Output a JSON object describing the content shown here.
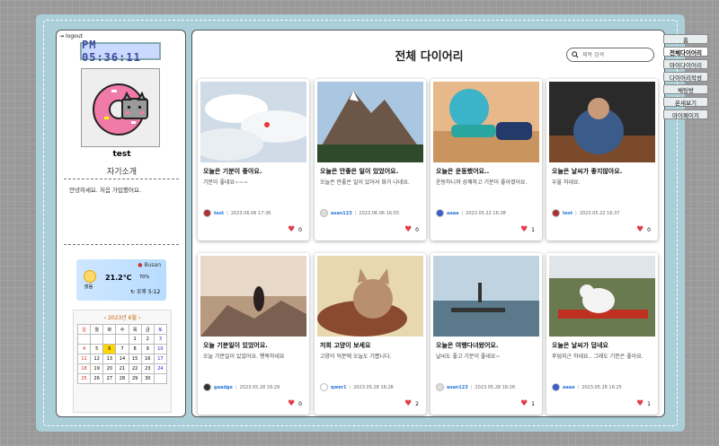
{
  "sidebar": {
    "logout_label": "logout",
    "clock": "PM 05:36:11",
    "username": "test",
    "intro_title": "자기소개",
    "intro_text": "안녕하세요. 처음 가입했어요.",
    "weather": {
      "location": "Busan",
      "temp": "21.2℃",
      "condition": "맑음",
      "humidity": "70%",
      "time": "오후 5:12"
    },
    "calendar": {
      "title": "2023년 6월",
      "weekdays": [
        "일",
        "월",
        "화",
        "수",
        "목",
        "금",
        "토"
      ],
      "weeks": [
        [
          "",
          "",
          "",
          "",
          "1",
          "2",
          "3"
        ],
        [
          "4",
          "5",
          "6",
          "7",
          "8",
          "9",
          "10"
        ],
        [
          "11",
          "12",
          "13",
          "14",
          "15",
          "16",
          "17"
        ],
        [
          "18",
          "19",
          "20",
          "21",
          "22",
          "23",
          "24"
        ],
        [
          "25",
          "26",
          "27",
          "28",
          "29",
          "30",
          ""
        ]
      ],
      "highlight": "6"
    }
  },
  "main": {
    "title": "전체 다이어리",
    "search_placeholder": "제목 검색"
  },
  "cards": [
    {
      "title": "오늘은 기분이 좋아요.",
      "sub": "기분이 좋네요~~~",
      "author": "test",
      "date": "2023.06.06 17:36",
      "likes": "0",
      "img": "sky",
      "avatar": "#a33"
    },
    {
      "title": "오늘은 안좋은 일이 있었어요.",
      "sub": "오늘은 안좋은 일이 있어서 화가 나네요.",
      "author": "asan123",
      "date": "2023.06.06 16:55",
      "likes": "0",
      "img": "mountain",
      "avatar": "#ddd"
    },
    {
      "title": "오늘은 운동했어요..",
      "sub": "운동하니까 상쾌하고 기분이 좋아졌어요.",
      "author": "aaaa",
      "date": "2023.05.22 16:38",
      "likes": "1",
      "img": "gym",
      "avatar": "#3a5fcd"
    },
    {
      "title": "오늘은 날씨가 좋지않아요.",
      "sub": "우울 하네요.",
      "author": "test",
      "date": "2023.05.22 16:37",
      "likes": "0",
      "img": "sad",
      "avatar": "#a33"
    },
    {
      "title": "오늘 기분일이 있었어요.",
      "sub": "오늘 기분일이 있었어요. 행복하네요",
      "author": "gaadge",
      "date": "2023.05.28 16:29",
      "likes": "0",
      "img": "sunset",
      "avatar": "#333"
    },
    {
      "title": "저희 고양이 보세요",
      "sub": "고양이 덕분에 오늘도 기쁩니다.",
      "author": "qwer1",
      "date": "2023.05.28 16:28",
      "likes": "2",
      "img": "cat",
      "avatar": "#fff"
    },
    {
      "title": "오늘은 여행다녀왔어요.",
      "sub": "날씨도 좋고 기분이 좋네요~",
      "author": "asan123",
      "date": "2023.05.28 16:26",
      "likes": "1",
      "img": "sea",
      "avatar": "#ddd"
    },
    {
      "title": "오늘은 날씨가 덥네요",
      "sub": "후덥지근 하네요.. 그래도 기분은 좋아요.",
      "author": "aaaa",
      "date": "2023.05.28 16:25",
      "likes": "1",
      "img": "dog",
      "avatar": "#3a5fcd"
    }
  ],
  "nav": [
    "홈",
    "전체다이어리",
    "마이다이어리",
    "다이어리작성",
    "채팅방",
    "온새보기",
    "마이페이지"
  ],
  "nav_active": "전체다이어리"
}
